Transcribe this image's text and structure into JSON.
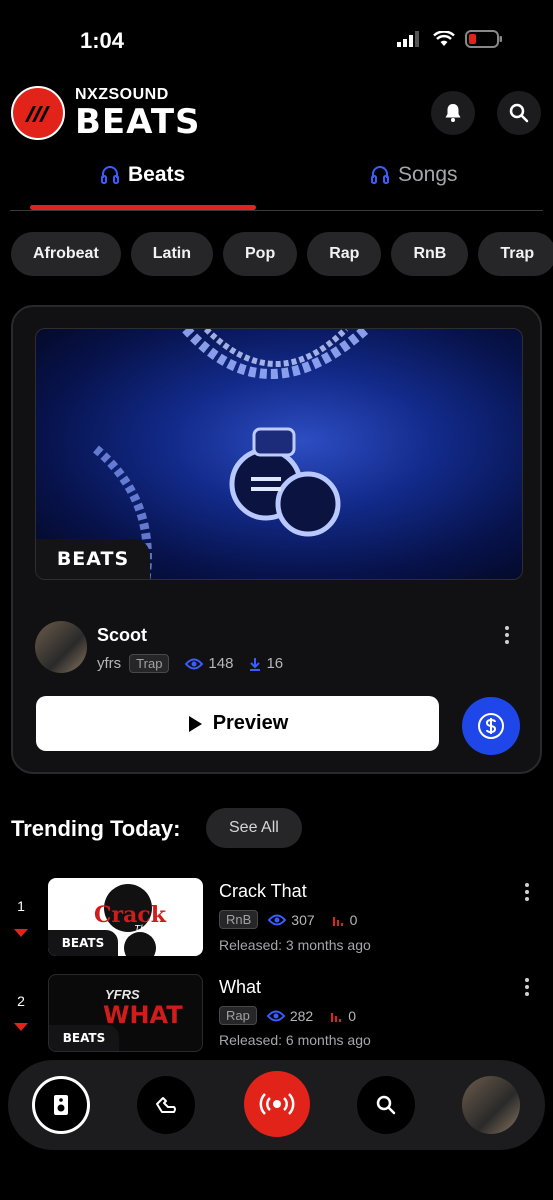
{
  "status_bar": {
    "time": "1:04"
  },
  "header": {
    "brand_top": "NXZSOUND",
    "brand_bottom": "BEATS"
  },
  "tabs": [
    {
      "label": "Beats",
      "active": true
    },
    {
      "label": "Songs",
      "active": false
    }
  ],
  "genres": [
    "Afrobeat",
    "Latin",
    "Pop",
    "Rap",
    "RnB",
    "Trap"
  ],
  "featured": {
    "badge": "BEATS",
    "title": "Scoot",
    "artist": "yfrs",
    "genre": "Trap",
    "views": "148",
    "downloads": "16",
    "preview_label": "Preview"
  },
  "trending": {
    "title": "Trending Today:",
    "see_all": "See All",
    "items": [
      {
        "rank": "1",
        "title": "Crack That",
        "genre": "RnB",
        "views": "307",
        "plays": "0",
        "released": "Released: 3 months ago",
        "badge": "BEATS",
        "art_text": "Crack",
        "art_sub": "That"
      },
      {
        "rank": "2",
        "title": "What",
        "genre": "Rap",
        "views": "282",
        "plays": "0",
        "released": "Released: 6 months ago",
        "badge": "BEATS",
        "art_text": "WHAT",
        "art_sub": "YFRS"
      }
    ]
  },
  "colors": {
    "accent_red": "#e2231a",
    "accent_blue": "#1f46e8",
    "icon_blue": "#3b5cff"
  },
  "icons": [
    "bell-icon",
    "search-icon",
    "headphones-icon",
    "play-icon",
    "dollar-icon",
    "eye-icon",
    "download-icon",
    "chart-icon",
    "speaker-icon",
    "hand-icon",
    "broadcast-icon"
  ]
}
